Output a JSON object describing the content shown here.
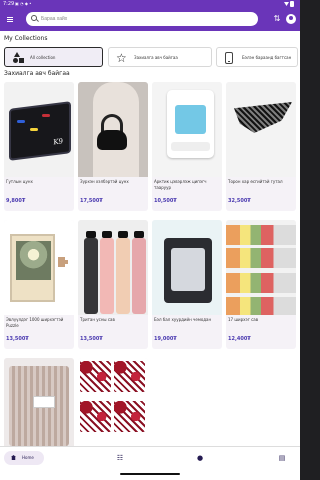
{
  "status": {
    "time": "7:29",
    "icons": "▣ ◔ ◆ •"
  },
  "search": {
    "placeholder": "Бараа хайх"
  },
  "sections": {
    "collections": "My Collections",
    "recent": "Захиалга авч байгаа"
  },
  "collections": [
    {
      "label": "All collection",
      "icon": "shapes-icon"
    },
    {
      "label": "Захиалга авч байгаа",
      "icon": "star-icon"
    },
    {
      "label": "Бэлэн бараанд багтсан",
      "icon": "phone-icon"
    }
  ],
  "products": [
    {
      "name": "Гутлын цүнх",
      "price": "9,800₮"
    },
    {
      "name": "Зүрхэн хэлбэртэй цүнх",
      "price": "17,500₮"
    },
    {
      "name": "Арктик цэвэрлэж ципэгч тааруур",
      "price": "10,500₮"
    },
    {
      "name": "Торон хар өсгийтэй гутал",
      "price": "32,500₮"
    },
    {
      "name": "Эвлүүлдэг 1000 ширхэгтэй Puzzle",
      "price": "13,500₮"
    },
    {
      "name": "Тритан усны сав",
      "price": "13,500₮"
    },
    {
      "name": "Бэл бал хуурдийн чемодан",
      "price": "19,000₮"
    },
    {
      "name": "17 ширхэг сав",
      "price": "12,400₮"
    },
    {
      "name": "",
      "price": ""
    },
    {
      "name": "",
      "price": ""
    }
  ],
  "nav": {
    "home": "Home",
    "list_icon": "☷",
    "bell_icon": "●",
    "cart_icon": "▤"
  },
  "colors": {
    "primary": "#6a35b9",
    "price": "#4b3ab0"
  }
}
